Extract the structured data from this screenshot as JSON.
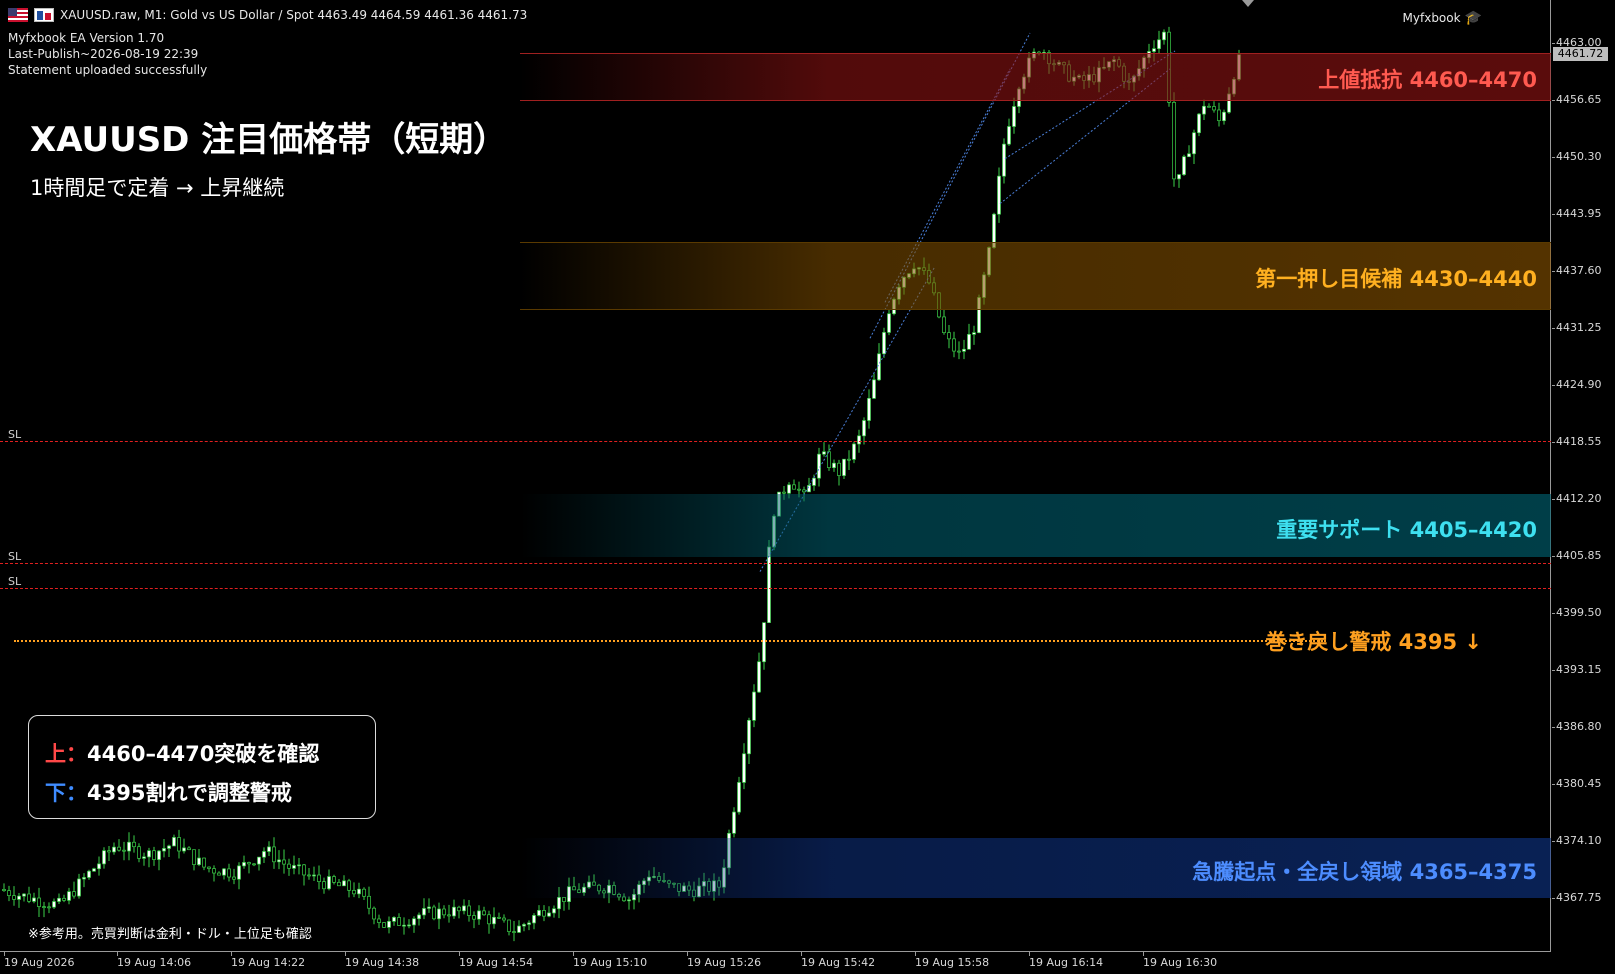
{
  "window": {
    "symbol_info": "XAUUSD.raw, M1:  Gold vs US Dollar / Spot  4463.49 4464.59 4461.36 4461.73",
    "ea_version": "Myfxbook EA Version 1.70",
    "last_publish": "Last-Publish~2026-08-19 22:39",
    "statement_status": "Statement uploaded successfully",
    "brand": "Myfxbook",
    "brand_icon": "graduation-cap-icon"
  },
  "overlay": {
    "title": "XAUUSD 注目価格帯（短期）",
    "subtitle": "1時間足で定着 → 上昇継続",
    "zones": {
      "resistance": "上値抵抗 4460–4470",
      "pullback": "第一押し目候補 4430–4440",
      "support": "重要サポート 4405–4420",
      "origin": "急騰起点・全戻し領域 4365–4375"
    },
    "warning_label": "巻き戻し警戒 4395 ↓",
    "sl_label": "SL",
    "box": {
      "up_tag": "上：",
      "up_text": "4460–4470突破を確認",
      "down_tag": "下：",
      "down_text": "4395割れで調整警戒"
    },
    "disclaimer": "※参考用。売買判断は金利・ドル・上位足も確認"
  },
  "price_axis": {
    "ticks": [
      "4463.00",
      "4456.65",
      "4450.30",
      "4443.95",
      "4437.60",
      "4431.25",
      "4424.90",
      "4418.55",
      "4412.20",
      "4405.85",
      "4399.50",
      "4393.15",
      "4386.80",
      "4380.45",
      "4374.10",
      "4367.75"
    ],
    "current": "4461.72"
  },
  "time_axis": {
    "ticks": [
      "19 Aug 2026",
      "19 Aug 14:06",
      "19 Aug 14:22",
      "19 Aug 14:38",
      "19 Aug 14:54",
      "19 Aug 15:10",
      "19 Aug 15:26",
      "19 Aug 15:42",
      "19 Aug 15:58",
      "19 Aug 16:14",
      "19 Aug 16:30"
    ]
  },
  "colors": {
    "bull_candle": "#ffffff",
    "bear_candle": "#000000",
    "wick": "#3cd24a",
    "sl_line": "#e02020",
    "warning": "#ffa020",
    "trade_line": "#4a7fd8"
  },
  "chart_data": {
    "type": "candlestick",
    "timeframe": "M1",
    "y_range": [
      4363,
      4470
    ],
    "stop_loss_levels": [
      4418.6,
      4405,
      4402.2
    ],
    "warning_level": 4395,
    "zones": [
      [
        4460,
        4470
      ],
      [
        4430,
        4440
      ],
      [
        4405,
        4420
      ],
      [
        4365,
        4375
      ]
    ],
    "close_path": [
      [
        0,
        4368.6
      ],
      [
        25,
        4367.8
      ],
      [
        60,
        4366.8
      ],
      [
        90,
        4370.5
      ],
      [
        115,
        4373.5
      ],
      [
        150,
        4372.5
      ],
      [
        175,
        4373.8
      ],
      [
        205,
        4371.0
      ],
      [
        235,
        4370.5
      ],
      [
        265,
        4373.0
      ],
      [
        290,
        4371.0
      ],
      [
        320,
        4369.5
      ],
      [
        355,
        4368.5
      ],
      [
        385,
        4364.5
      ],
      [
        420,
        4365.8
      ],
      [
        450,
        4366.2
      ],
      [
        480,
        4365.8
      ],
      [
        515,
        4364.0
      ],
      [
        545,
        4366.5
      ],
      [
        575,
        4368.5
      ],
      [
        610,
        4369.0
      ],
      [
        630,
        4367.5
      ],
      [
        650,
        4370.5
      ],
      [
        665,
        4369.0
      ],
      [
        690,
        4368.5
      ],
      [
        720,
        4369.0
      ],
      [
        735,
        4378.5
      ],
      [
        750,
        4388.5
      ],
      [
        762,
        4396.0
      ],
      [
        772,
        4410.5
      ],
      [
        790,
        4414.5
      ],
      [
        805,
        4412.0
      ],
      [
        820,
        4417.0
      ],
      [
        840,
        4415.0
      ],
      [
        860,
        4419.0
      ],
      [
        875,
        4425.5
      ],
      [
        888,
        4433.0
      ],
      [
        900,
        4436.5
      ],
      [
        915,
        4438.5
      ],
      [
        930,
        4436.0
      ],
      [
        945,
        4430.0
      ],
      [
        960,
        4428.0
      ],
      [
        975,
        4431.5
      ],
      [
        990,
        4440.0
      ],
      [
        1005,
        4452.5
      ],
      [
        1020,
        4459.0
      ],
      [
        1040,
        4462.5
      ],
      [
        1060,
        4460.0
      ],
      [
        1080,
        4458.5
      ],
      [
        1100,
        4459.5
      ],
      [
        1115,
        4461.0
      ],
      [
        1130,
        4458.0
      ],
      [
        1150,
        4462.5
      ],
      [
        1165,
        4464.0
      ],
      [
        1175,
        4446.0
      ],
      [
        1188,
        4451.0
      ],
      [
        1205,
        4456.5
      ],
      [
        1220,
        4454.0
      ],
      [
        1235,
        4460.0
      ],
      [
        1243,
        4461.7
      ]
    ]
  }
}
